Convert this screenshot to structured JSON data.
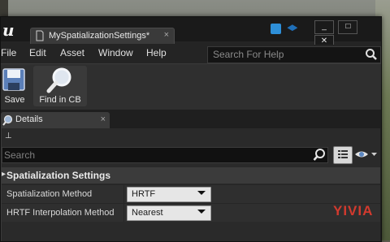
{
  "window": {
    "tab_title": "MySpatializationSettings*",
    "buttons": [
      "_",
      "□",
      "✕"
    ]
  },
  "menu": {
    "items": [
      "File",
      "Edit",
      "Asset",
      "Window",
      "Help"
    ],
    "search_placeholder": "Search For Help"
  },
  "toolbar": {
    "save_label": "Save",
    "find_label": "Find in CB"
  },
  "details": {
    "tab_label": "Details",
    "search_placeholder": "Search",
    "category_label": "Spatialization Settings",
    "properties": [
      {
        "name": "Spatialization Method",
        "value": "HRTF"
      },
      {
        "name": "HRTF Interpolation Method",
        "value": "Nearest"
      }
    ]
  },
  "watermark": "YIVIA",
  "colors": {
    "accent_blue": "#3aa0e0",
    "watermark_red": "#d23a2e",
    "watermark_blue": "#2c6fd0"
  }
}
